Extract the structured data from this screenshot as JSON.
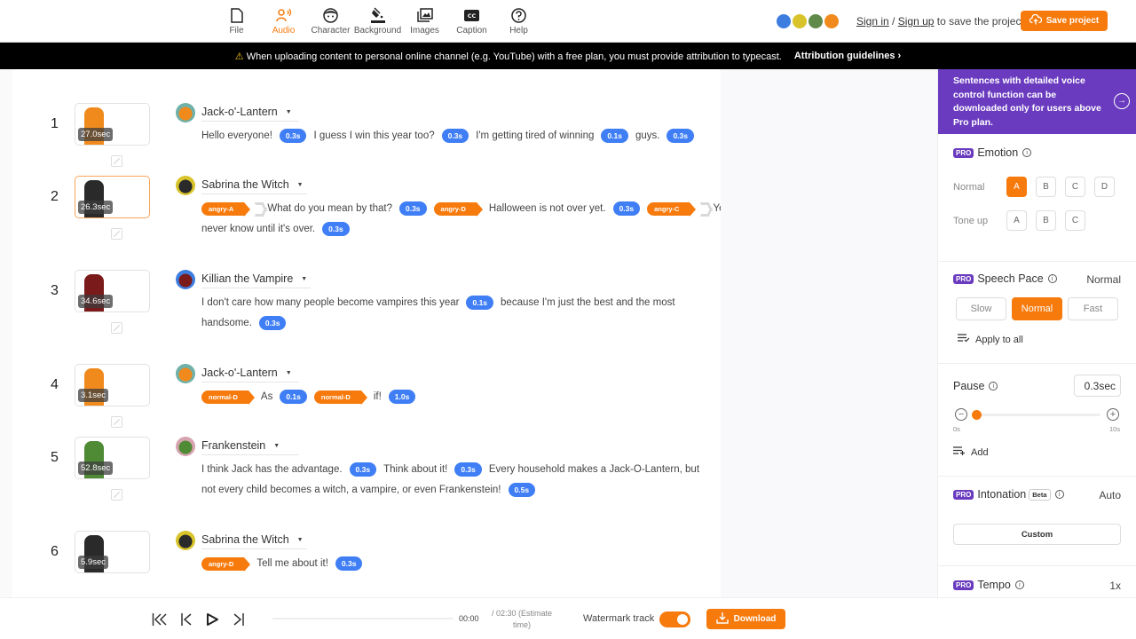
{
  "topbar": {
    "nav": [
      {
        "id": "file",
        "label": "File",
        "icon": "file-icon",
        "active": false
      },
      {
        "id": "audio",
        "label": "Audio",
        "icon": "audio-icon",
        "active": true
      },
      {
        "id": "character",
        "label": "Character",
        "icon": "character-icon",
        "active": false
      },
      {
        "id": "background",
        "label": "Background",
        "icon": "paint-bucket-icon",
        "active": false
      },
      {
        "id": "images",
        "label": "Images",
        "icon": "images-icon",
        "active": false
      },
      {
        "id": "caption",
        "label": "Caption",
        "icon": "cc-icon",
        "active": false
      },
      {
        "id": "help",
        "label": "Help",
        "icon": "help-icon",
        "active": false
      }
    ],
    "avatars": [
      "Killian the Vampire",
      "Sabrina the Witch",
      "Frankenstein",
      "Jack-o'-Lantern"
    ],
    "sign_in": "Sign in",
    "separator": " / ",
    "sign_up": "Sign up",
    "sign_suffix": " to save the project",
    "save_label": "Save project"
  },
  "banner": {
    "warning_icon": "⚠",
    "text": "When uploading content to personal online channel (e.g. YouTube) with a free plan, you must provide attribution to typecast.",
    "link": "Attribution guidelines ›"
  },
  "characters": {
    "jack": {
      "name": "Jack-o'-Lantern",
      "color": "#f08a1c",
      "bg": "#6fb0a8"
    },
    "sabrina": {
      "name": "Sabrina the Witch",
      "color": "#2a2a2a",
      "bg": "#d8c42a"
    },
    "killian": {
      "name": "Killian the Vampire",
      "color": "#7a1a1a",
      "bg": "#3d7de0"
    },
    "frank": {
      "name": "Frankenstein",
      "color": "#4f8a34",
      "bg": "#d7a3b0"
    }
  },
  "rows": [
    {
      "num": "1",
      "duration": "27.0sec",
      "speaker": "Jack-o'-Lantern",
      "char": "jack",
      "selected": false,
      "lines": [
        [
          {
            "t": "text",
            "v": " Hello everyone!"
          },
          {
            "t": "pause",
            "v": "0.3s"
          },
          {
            "t": "text",
            "v": "I guess I win this year too?"
          },
          {
            "t": "pause",
            "v": "0.3s"
          },
          {
            "t": "text",
            "v": "I'm getting tired of winning"
          },
          {
            "t": "pause",
            "v": "0.1s"
          },
          {
            "t": "text",
            "v": " guys."
          },
          {
            "t": "pause",
            "v": "0.3s"
          }
        ]
      ]
    },
    {
      "num": "2",
      "duration": "26.3sec",
      "speaker": "Sabrina the Witch",
      "char": "sabrina",
      "selected": true,
      "lines": [
        [
          {
            "t": "emo",
            "v": "angry-A"
          },
          {
            "t": "chev"
          },
          {
            "t": "text",
            "v": "What do you mean by that?"
          },
          {
            "t": "pause",
            "v": "0.3s"
          },
          {
            "t": "emo",
            "v": "angry-D"
          },
          {
            "t": "text",
            "v": "Halloween is not over yet."
          },
          {
            "t": "pause",
            "v": "0.3s"
          },
          {
            "t": "emo",
            "v": "angry-C"
          },
          {
            "t": "chev"
          },
          {
            "t": "text",
            "v": "You"
          }
        ],
        [
          {
            "t": "text",
            "v": "never know until it's over."
          },
          {
            "t": "pause",
            "v": "0.3s"
          }
        ]
      ]
    },
    {
      "num": "3",
      "duration": "34.6sec",
      "speaker": "Killian the Vampire",
      "char": "killian",
      "selected": false,
      "lines": [
        [
          {
            "t": "text",
            "v": " I don't care how many people become vampires this year"
          },
          {
            "t": "pause",
            "v": "0.1s"
          },
          {
            "t": "text",
            "v": " because I'm just the best and the most"
          }
        ],
        [
          {
            "t": "text",
            "v": "handsome."
          },
          {
            "t": "pause",
            "v": "0.3s"
          }
        ]
      ]
    },
    {
      "num": "4",
      "duration": "3.1sec",
      "speaker": "Jack-o'-Lantern",
      "char": "jack",
      "selected": false,
      "lines": [
        [
          {
            "t": "emo",
            "v": "normal-D"
          },
          {
            "t": "text",
            "v": "As"
          },
          {
            "t": "pause",
            "v": "0.1s"
          },
          {
            "t": "emo",
            "v": "normal-D"
          },
          {
            "t": "text",
            "v": "if!"
          },
          {
            "t": "pause",
            "v": "1.0s"
          }
        ]
      ]
    },
    {
      "num": "5",
      "duration": "52.8sec",
      "speaker": "Frankenstein",
      "char": "frank",
      "selected": false,
      "lines": [
        [
          {
            "t": "text",
            "v": " I think Jack has the advantage."
          },
          {
            "t": "pause",
            "v": "0.3s"
          },
          {
            "t": "text",
            "v": "Think about it!"
          },
          {
            "t": "pause",
            "v": "0.3s"
          },
          {
            "t": "text",
            "v": "Every household makes a Jack-O-Lantern, but"
          }
        ],
        [
          {
            "t": "text",
            "v": "not every child becomes a witch, a vampire, or even Frankenstein!"
          },
          {
            "t": "pause",
            "v": "0.5s"
          }
        ]
      ]
    },
    {
      "num": "6",
      "duration": "5.9sec",
      "speaker": "Sabrina the Witch",
      "char": "sabrina",
      "selected": false,
      "lines": [
        [
          {
            "t": "emo",
            "v": "angry-D"
          },
          {
            "t": "text",
            "v": "Tell me about it!"
          },
          {
            "t": "pause",
            "v": "0.3s"
          }
        ]
      ]
    }
  ],
  "panel": {
    "promo": "Sentences with detailed voice control function can be downloaded only for users above Pro plan.",
    "pro_badge": "PRO",
    "emotion": {
      "title": "Emotion",
      "groups": [
        {
          "label": "Normal",
          "options": [
            "A",
            "B",
            "C",
            "D"
          ],
          "selected": "A"
        },
        {
          "label": "Tone up",
          "options": [
            "A",
            "B",
            "C"
          ],
          "selected": null
        }
      ]
    },
    "speech_pace": {
      "title": "Speech Pace",
      "value": "Normal",
      "options": [
        "Slow",
        "Normal",
        "Fast"
      ],
      "selected": "Normal",
      "apply_all": "Apply to all"
    },
    "pause": {
      "title": "Pause",
      "value": "0.3sec",
      "min_label": "0s",
      "max_label": "10s",
      "min": 0,
      "max": 10,
      "current": 0.3,
      "add_label": "Add"
    },
    "intonation": {
      "title": "Intonation",
      "beta": "Beta",
      "value": "Auto",
      "custom_label": "Custom"
    },
    "tempo": {
      "title": "Tempo",
      "value": "1x"
    }
  },
  "player": {
    "current_time": "00:00",
    "estimate": "/ 02:30 (Estimate time)",
    "progress": 0,
    "watermark_label": "Watermark track",
    "watermark_on": true,
    "download_label": "Download"
  },
  "colors": {
    "accent": "#f77a0c",
    "pro": "#6a3bbf",
    "pause_chip": "#3f7ef5"
  }
}
